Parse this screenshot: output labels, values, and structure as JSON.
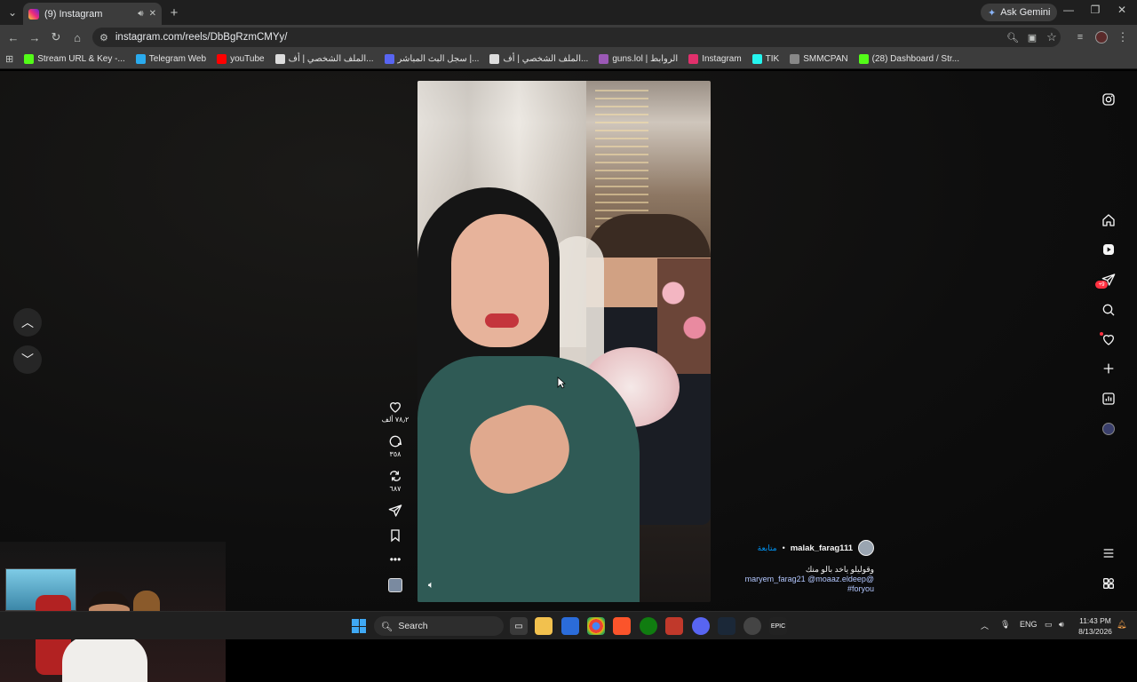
{
  "browser": {
    "tab_title": "(9) Instagram",
    "new_tab": "+",
    "gemini_label": "Ask Gemini",
    "url": "instagram.com/reels/DbBgRzmCMYy/"
  },
  "bookmarks": [
    {
      "label": "Stream URL & Key -...",
      "color": "#53fc18"
    },
    {
      "label": "Telegram Web",
      "color": "#2aabee"
    },
    {
      "label": "youTube",
      "color": "#ff0000"
    },
    {
      "label": "الملف الشخصي | أف...",
      "color": "#dddddd"
    },
    {
      "label": "سجل البث المباشر |...",
      "color": "#5865f2"
    },
    {
      "label": "الملف الشخصي | أف...",
      "color": "#dddddd"
    },
    {
      "label": "guns.lol | الروابط",
      "color": "#9b59b6"
    },
    {
      "label": "Instagram",
      "color": "#e1306c"
    },
    {
      "label": "TIK",
      "color": "#25f4ee"
    },
    {
      "label": "SMMCPAN",
      "color": "#888888"
    },
    {
      "label": "(28) Dashboard / Str...",
      "color": "#53fc18"
    }
  ],
  "reel": {
    "actions": {
      "likes": "٧٨٫٢ ألف",
      "comments": "٣٥٨",
      "reposts": "٦٨٧"
    },
    "caption": {
      "username": "malak_farag111",
      "separator": "•",
      "follow_label": "متابعة",
      "text": "وقوليلو ياخد بالو منك",
      "mentions": "maryem_farag21 @moaaz.eldeep@",
      "hashtag": "#foryou"
    }
  },
  "taskbar": {
    "search_label": "Search",
    "lang": "ENG",
    "time": "11:43 PM",
    "date": "8/13/2026"
  },
  "right_nav": {
    "notification_badge": "+9"
  },
  "colors": {
    "accent_blue": "#0095f6",
    "badge_red": "#ff3040",
    "chrome_dark": "#1f1f1f",
    "chrome_toolbar": "#3c3c3c"
  }
}
